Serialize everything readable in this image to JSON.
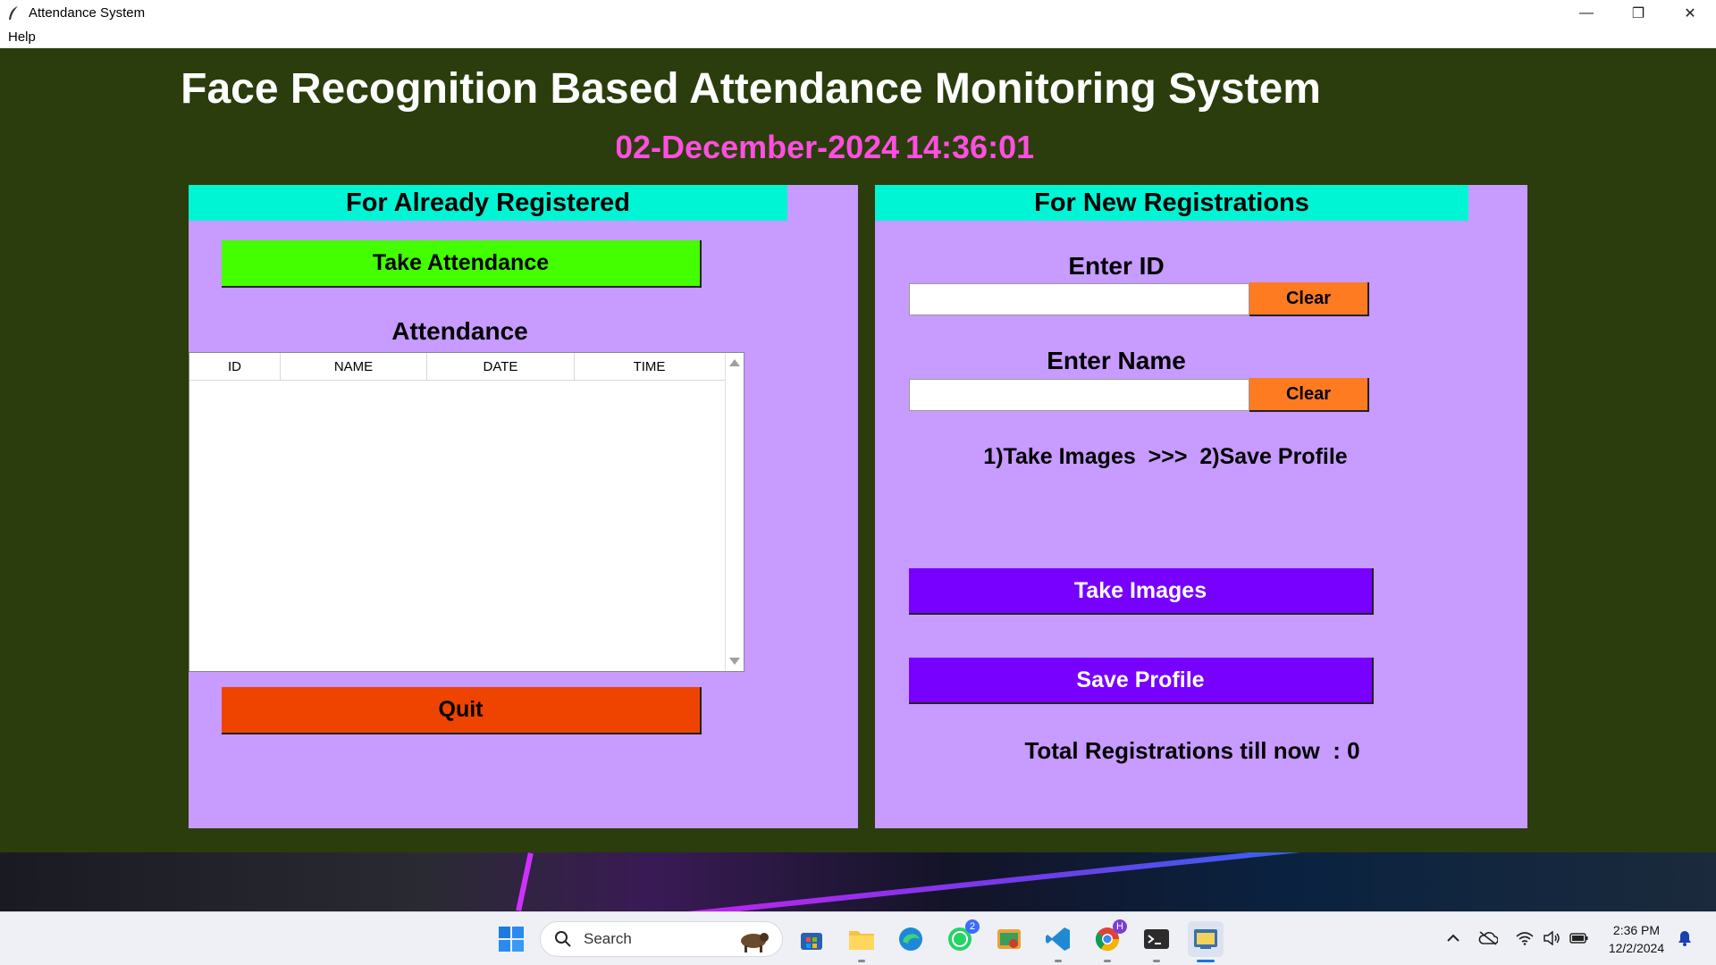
{
  "window": {
    "title": "Attendance System",
    "controls": {
      "minimize": "—",
      "restore": "❐",
      "close": "✕"
    }
  },
  "menubar": {
    "items": [
      "Help"
    ]
  },
  "app": {
    "main_title": "Face Recognition Based Attendance Monitoring System",
    "date": "02-December-2024",
    "time": "14:36:01",
    "colors": {
      "background": "#2b3d0c",
      "panel": "#c79bff",
      "header": "#00f5d4",
      "datetime": "#ff4fe0"
    }
  },
  "left_panel": {
    "header": "For Already Registered",
    "take_attendance_label": "Take Attendance",
    "attendance_label": "Attendance",
    "table": {
      "columns": [
        "ID",
        "NAME",
        "DATE",
        "TIME"
      ],
      "rows": []
    },
    "quit_label": "Quit"
  },
  "right_panel": {
    "header": "For New Registrations",
    "enter_id_label": "Enter ID",
    "id_value": "",
    "clear_id_label": "Clear",
    "enter_name_label": "Enter Name",
    "name_value": "",
    "clear_name_label": "Clear",
    "steps_text": "1)Take Images  >>>  2)Save Profile",
    "take_images_label": "Take Images",
    "save_profile_label": "Save Profile",
    "total_text": "Total Registrations till now  : 0"
  },
  "taskbar": {
    "search_placeholder": "Search",
    "whatsapp_badge": "2",
    "chrome_badge": "H",
    "clock_time": "2:36 PM",
    "clock_date": "12/2/2024"
  }
}
